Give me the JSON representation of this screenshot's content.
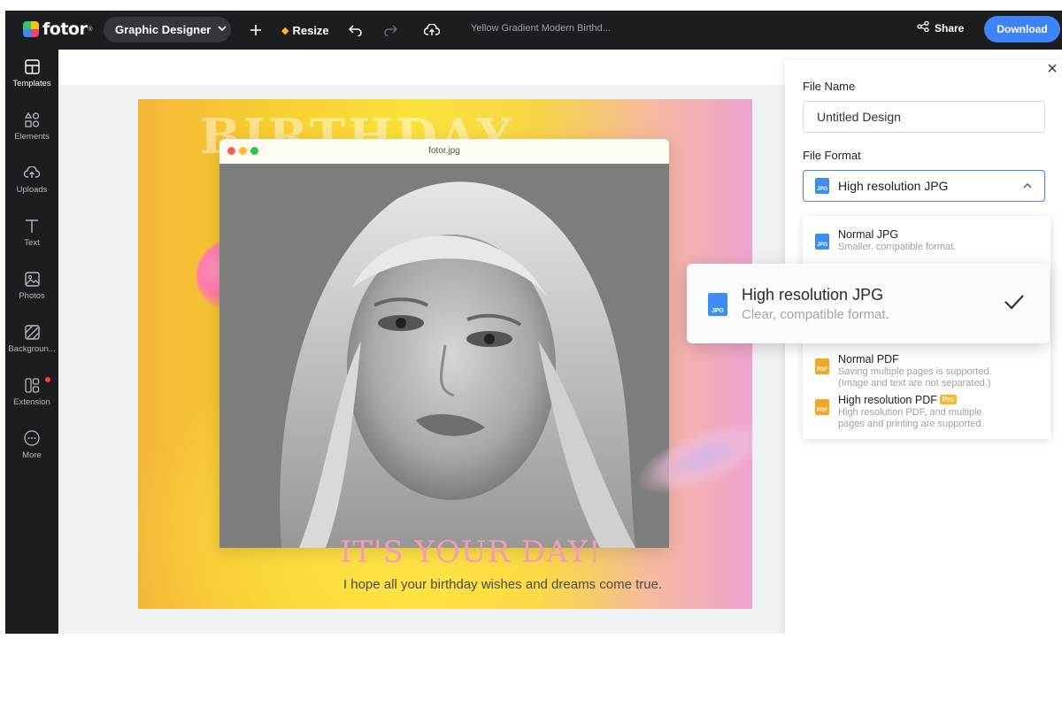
{
  "topbar": {
    "logo_text": "fotor",
    "logo_mark": "®",
    "role": "Graphic Designer",
    "resize_label": "Resize",
    "doc_title": "Yellow Gradient Modern Birthd...",
    "share_label": "Share",
    "download_label": "Download"
  },
  "sidebar": {
    "items": [
      {
        "label": "Templates",
        "icon": "templates-icon"
      },
      {
        "label": "Elements",
        "icon": "elements-icon"
      },
      {
        "label": "Uploads",
        "icon": "uploads-icon"
      },
      {
        "label": "Text",
        "icon": "text-icon"
      },
      {
        "label": "Photos",
        "icon": "photos-icon"
      },
      {
        "label": "Backgroun...",
        "icon": "background-icon"
      },
      {
        "label": "Extension",
        "icon": "extension-icon"
      },
      {
        "label": "More",
        "icon": "more-icon"
      }
    ]
  },
  "design": {
    "headline": "BIRTHDAY",
    "browser_title": "fotor.jpg",
    "tagline": "IT'S YOUR DAY!",
    "wish": "I hope all your birthday wishes and dreams come true."
  },
  "panel": {
    "file_name_label": "File Name",
    "file_name_value": "Untitled Design",
    "file_format_label": "File Format",
    "selected_format": "High resolution JPG",
    "options": [
      {
        "title": "Normal JPG",
        "desc": "Smaller, compatible format.",
        "type": "JPG"
      },
      {
        "title": "Normal PDF",
        "desc1": "Saving multiple pages is supported.",
        "desc2": "(Image and text are not separated.)",
        "type": "PDF"
      },
      {
        "title": "High resolution PDF",
        "badge": "Pro",
        "desc1": "High resolution PDF, and multiple",
        "desc2": "pages and printing are supported.",
        "type": "PDF"
      }
    ],
    "zoom_option": {
      "title": "High resolution JPG",
      "desc": "Clear, compatible format.",
      "type": "JPG"
    }
  },
  "colors": {
    "accent": "#3e83f8",
    "topbar_bg": "#1c1d20",
    "tagline": "#f49bb8"
  }
}
